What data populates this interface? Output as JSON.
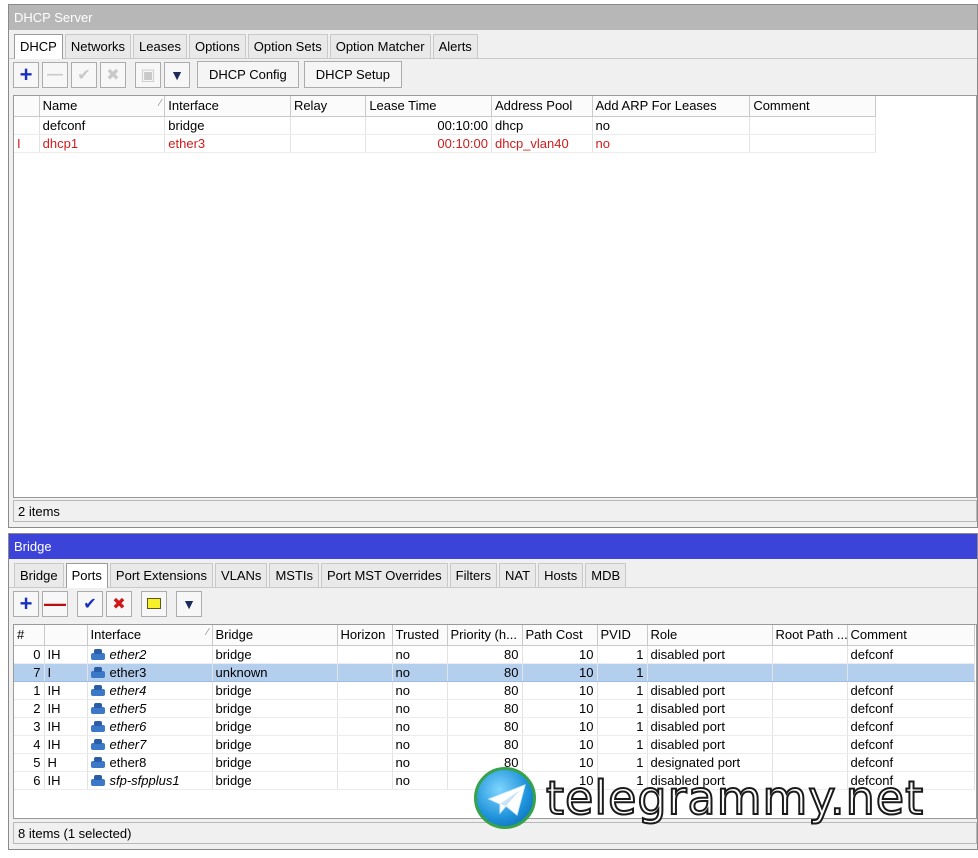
{
  "dhcp_window": {
    "title": "DHCP Server",
    "tabs": [
      "DHCP",
      "Networks",
      "Leases",
      "Options",
      "Option Sets",
      "Option Matcher",
      "Alerts"
    ],
    "toolbar": {
      "config_label": "DHCP Config",
      "setup_label": "DHCP Setup"
    },
    "columns": [
      "",
      "Name",
      "Interface",
      "Relay",
      "Lease Time",
      "Address Pool",
      "Add ARP For Leases",
      "Comment"
    ],
    "rows": [
      {
        "flag": "",
        "name": "defconf",
        "interface": "bridge",
        "relay": "",
        "lease_time": "00:10:00",
        "pool": "dhcp",
        "add_arp": "no",
        "comment": "",
        "disabled": false
      },
      {
        "flag": "I",
        "name": "dhcp1",
        "interface": "ether3",
        "relay": "",
        "lease_time": "00:10:00",
        "pool": "dhcp_vlan40",
        "add_arp": "no",
        "comment": "",
        "disabled": true
      }
    ],
    "status": "2 items"
  },
  "bridge_window": {
    "title": "Bridge",
    "tabs": [
      "Bridge",
      "Ports",
      "Port Extensions",
      "VLANs",
      "MSTIs",
      "Port MST Overrides",
      "Filters",
      "NAT",
      "Hosts",
      "MDB"
    ],
    "columns": [
      "#",
      "",
      "Interface",
      "Bridge",
      "Horizon",
      "Trusted",
      "Priority (h...",
      "Path Cost",
      "PVID",
      "Role",
      "Root Path ...",
      "Comment"
    ],
    "rows": [
      {
        "num": "0",
        "flags": "IH",
        "interface": "ether2",
        "italic": true,
        "bridge": "bridge",
        "horizon": "",
        "trusted": "no",
        "priority": "80",
        "path_cost": "10",
        "pvid": "1",
        "role": "disabled port",
        "root_path": "",
        "comment": "defconf",
        "selected": false
      },
      {
        "num": "7",
        "flags": "I",
        "interface": "ether3",
        "italic": false,
        "bridge": "unknown",
        "horizon": "",
        "trusted": "no",
        "priority": "80",
        "path_cost": "10",
        "pvid": "1",
        "role": "",
        "root_path": "",
        "comment": "",
        "selected": true
      },
      {
        "num": "1",
        "flags": "IH",
        "interface": "ether4",
        "italic": true,
        "bridge": "bridge",
        "horizon": "",
        "trusted": "no",
        "priority": "80",
        "path_cost": "10",
        "pvid": "1",
        "role": "disabled port",
        "root_path": "",
        "comment": "defconf",
        "selected": false
      },
      {
        "num": "2",
        "flags": "IH",
        "interface": "ether5",
        "italic": true,
        "bridge": "bridge",
        "horizon": "",
        "trusted": "no",
        "priority": "80",
        "path_cost": "10",
        "pvid": "1",
        "role": "disabled port",
        "root_path": "",
        "comment": "defconf",
        "selected": false
      },
      {
        "num": "3",
        "flags": "IH",
        "interface": "ether6",
        "italic": true,
        "bridge": "bridge",
        "horizon": "",
        "trusted": "no",
        "priority": "80",
        "path_cost": "10",
        "pvid": "1",
        "role": "disabled port",
        "root_path": "",
        "comment": "defconf",
        "selected": false
      },
      {
        "num": "4",
        "flags": "IH",
        "interface": "ether7",
        "italic": true,
        "bridge": "bridge",
        "horizon": "",
        "trusted": "no",
        "priority": "80",
        "path_cost": "10",
        "pvid": "1",
        "role": "disabled port",
        "root_path": "",
        "comment": "defconf",
        "selected": false
      },
      {
        "num": "5",
        "flags": "H",
        "interface": "ether8",
        "italic": false,
        "bridge": "bridge",
        "horizon": "",
        "trusted": "no",
        "priority": "80",
        "path_cost": "10",
        "pvid": "1",
        "role": "designated port",
        "root_path": "",
        "comment": "defconf",
        "selected": false
      },
      {
        "num": "6",
        "flags": "IH",
        "interface": "sfp-sfpplus1",
        "italic": true,
        "bridge": "bridge",
        "horizon": "",
        "trusted": "no",
        "priority": "80",
        "path_cost": "10",
        "pvid": "1",
        "role": "disabled port",
        "root_path": "",
        "comment": "defconf",
        "selected": false
      }
    ],
    "status": "8 items (1 selected)"
  },
  "watermark": {
    "text": "telegrammy.net"
  },
  "colors": {
    "disabled_text": "#d01c1c",
    "selection": "#b4cfee",
    "active_titlebar": "#3b43d8",
    "inactive_titlebar": "#b7b7b7"
  }
}
